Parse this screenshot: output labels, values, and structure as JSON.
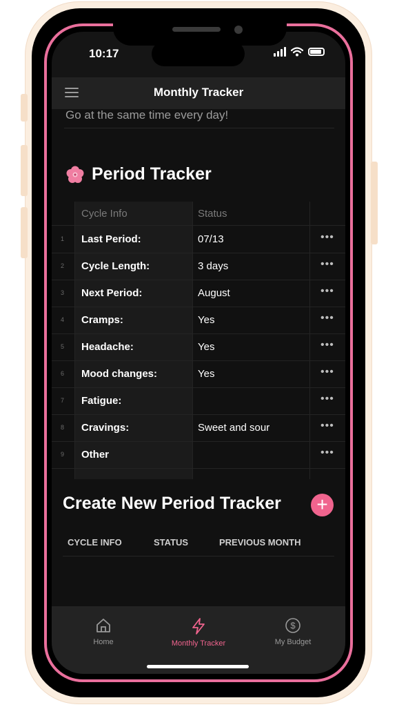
{
  "status_bar": {
    "time": "10:17"
  },
  "header": {
    "title": "Monthly Tracker"
  },
  "reminder": "Go at the same time every day!",
  "period_tracker": {
    "title": "Period Tracker",
    "columns": [
      "Cycle Info",
      "Status"
    ],
    "rows": [
      {
        "num": "1",
        "label": "Last Period:",
        "value": "07/13"
      },
      {
        "num": "2",
        "label": "Cycle Length:",
        "value": "3 days"
      },
      {
        "num": "3",
        "label": "Next Period:",
        "value": "August"
      },
      {
        "num": "4",
        "label": "Cramps:",
        "value": "Yes"
      },
      {
        "num": "5",
        "label": "Headache:",
        "value": "Yes"
      },
      {
        "num": "6",
        "label": "Mood changes:",
        "value": "Yes"
      },
      {
        "num": "7",
        "label": "Fatigue:",
        "value": ""
      },
      {
        "num": "8",
        "label": "Cravings:",
        "value": "Sweet and sour"
      },
      {
        "num": "9",
        "label": "Other",
        "value": ""
      }
    ],
    "row_menu": "•••"
  },
  "create": {
    "title": "Create New Period Tracker",
    "add_label": "+",
    "columns": [
      "CYCLE INFO",
      "STATUS",
      "PREVIOUS MONTH"
    ]
  },
  "tabs": [
    {
      "label": "Home",
      "icon": "home-icon",
      "active": false
    },
    {
      "label": "Monthly Tracker",
      "icon": "lightning-icon",
      "active": true
    },
    {
      "label": "My Budget",
      "icon": "dollar-circle-icon",
      "active": false
    }
  ],
  "colors": {
    "accent": "#f0648e",
    "frame_ring": "#ea6f9c",
    "background": "#111111"
  }
}
